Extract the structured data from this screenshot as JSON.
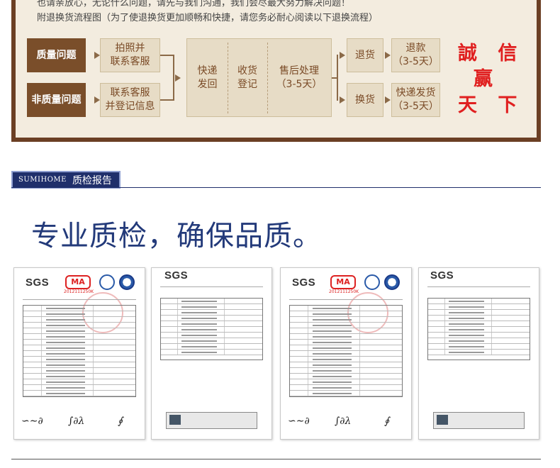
{
  "notice": {
    "line1": "也请亲放心，无论什么问题，请先与我们沟通，我们会尽最大努力解决问题！",
    "line2": "附退换货流程图（为了使退换货更加顺畅和快捷，请您务必耐心阅读以下退换流程）"
  },
  "flow": {
    "quality_issue": "质量问题",
    "non_quality_issue": "非质量问题",
    "photo_contact": "拍照并\n联系客服",
    "contact_register": "联系客服\n并登记信息",
    "ship_back": "快递\n发回",
    "receive_register": "收货\n登记",
    "after_sales": "售后处理\n（3-5天）",
    "return": "退货",
    "exchange": "换货",
    "refund": "退款\n（3-5天）",
    "express_ship": "快递发货\n（3-5天）"
  },
  "slogan": {
    "line1": "誠 信",
    "line2": "赢",
    "line3": "天 下"
  },
  "section": {
    "brand": "SUMIHOME",
    "title": "质检报告"
  },
  "headline": "专业质检，确保品质。",
  "certificates": [
    {
      "logo": "SGS",
      "ma": "MA",
      "ma_number": "2012111250K"
    },
    {
      "logo": "SGS"
    },
    {
      "logo": "SGS",
      "ma": "MA",
      "ma_number": "2012111250K"
    },
    {
      "logo": "SGS"
    }
  ],
  "colors": {
    "frame": "#6b3f24",
    "dark_box": "#7a4e2a",
    "light_box": "#e7dcc6",
    "slogan": "#e02020",
    "headline": "#233a7a",
    "section_tag": "#1f2f6b"
  }
}
